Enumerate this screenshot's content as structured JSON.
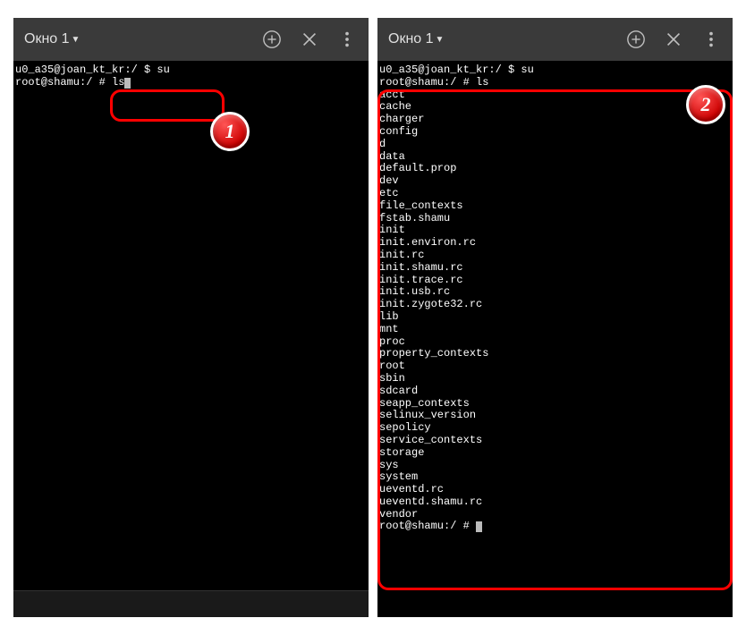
{
  "window": {
    "title": "Окно 1"
  },
  "screen1": {
    "line1": "u0_a35@joan_kt_kr:/ $ su",
    "line2_prefix": "root@shamu:/ # ls"
  },
  "screen2": {
    "line1": "u0_a35@joan_kt_kr:/ $ su",
    "line2": "root@shamu:/ # ls",
    "output": [
      "acct",
      "cache",
      "charger",
      "config",
      "d",
      "data",
      "default.prop",
      "dev",
      "etc",
      "file_contexts",
      "fstab.shamu",
      "init",
      "init.environ.rc",
      "init.rc",
      "init.shamu.rc",
      "init.trace.rc",
      "init.usb.rc",
      "init.zygote32.rc",
      "lib",
      "mnt",
      "proc",
      "property_contexts",
      "root",
      "sbin",
      "sdcard",
      "seapp_contexts",
      "selinux_version",
      "sepolicy",
      "service_contexts",
      "storage",
      "sys",
      "system",
      "ueventd.rc",
      "ueventd.shamu.rc",
      "vendor"
    ],
    "prompt_end": "root@shamu:/ # "
  },
  "badges": {
    "b1": "1",
    "b2": "2"
  }
}
